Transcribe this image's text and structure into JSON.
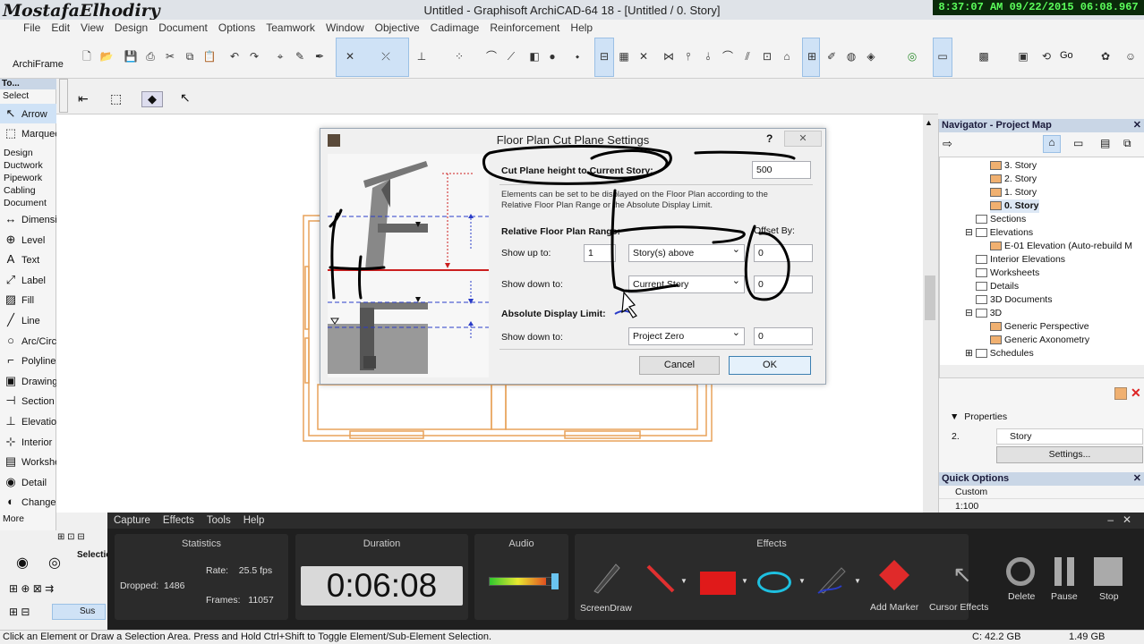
{
  "window": {
    "watermark": "MostafaElhodiry",
    "title": "Untitled - Graphisoft ArchiCAD-64 18 - [Untitled / 0. Story]",
    "clock": "8:37:07 AM 09/22/2015 06:08.967"
  },
  "menu": [
    "File",
    "Edit",
    "View",
    "Design",
    "Document",
    "Options",
    "Teamwork",
    "Window",
    "Objective",
    "Cadimage",
    "Reinforcement",
    "Help"
  ],
  "toolbar": {
    "archiframe": "ArchiFrame",
    "go": "Go"
  },
  "toolbox": {
    "header": "To...",
    "select_label": "Select",
    "tools": [
      {
        "label": "Arrow",
        "icon": "arrow-icon",
        "glyph": "↖"
      },
      {
        "label": "Marquee",
        "icon": "marquee-icon",
        "glyph": "⬚"
      }
    ],
    "groups": [
      "Design",
      "Ductwork",
      "Pipework",
      "Cabling",
      "Document"
    ],
    "doc_tools": [
      {
        "label": "Dimension",
        "icon": "dimension-icon",
        "glyph": "↔"
      },
      {
        "label": "Level",
        "icon": "level-icon",
        "glyph": "⊕"
      },
      {
        "label": "Text",
        "icon": "text-icon",
        "glyph": "A"
      },
      {
        "label": "Label",
        "icon": "label-icon",
        "glyph": "⤢"
      },
      {
        "label": "Fill",
        "icon": "fill-icon",
        "glyph": "▨"
      },
      {
        "label": "Line",
        "icon": "line-icon",
        "glyph": "╱"
      },
      {
        "label": "Arc/Circle",
        "icon": "circle-icon",
        "glyph": "○"
      },
      {
        "label": "Polyline",
        "icon": "polyline-icon",
        "glyph": "⌐"
      },
      {
        "label": "Drawing",
        "icon": "drawing-icon",
        "glyph": "▣"
      },
      {
        "label": "Section",
        "icon": "section-icon",
        "glyph": "⊣"
      },
      {
        "label": "Elevation",
        "icon": "elevation-icon",
        "glyph": "⊥"
      },
      {
        "label": "Interior",
        "icon": "interior-icon",
        "glyph": "⊹"
      },
      {
        "label": "Worksheet",
        "icon": "worksheet-icon",
        "glyph": "▤"
      },
      {
        "label": "Detail",
        "icon": "detail-icon",
        "glyph": "◉"
      },
      {
        "label": "Change",
        "icon": "change-icon",
        "glyph": "◐"
      }
    ],
    "more": "More"
  },
  "dialog": {
    "title": "Floor Plan Cut Plane Settings",
    "help": "?",
    "close": "✕",
    "cut_plane_label": "Cut Plane height to Current Story:",
    "cut_plane_value": "500",
    "description": "Elements can be set to be displayed on the Floor Plan according to the Relative Floor Plan Range or the Absolute Display Limit.",
    "relative_heading": "Relative Floor Plan Range:",
    "offset_by": "Offset By:",
    "show_up_to": "Show up to:",
    "up_count": "1",
    "up_select": "Story(s) above",
    "up_offset": "0",
    "show_down_to": "Show down to:",
    "down_select": "Current Story",
    "down_offset": "0",
    "absolute_heading": "Absolute Display Limit:",
    "abs_show_down_to": "Show down to:",
    "abs_select": "Project Zero",
    "abs_offset": "0",
    "cancel": "Cancel",
    "ok": "OK"
  },
  "navigator": {
    "title": "Navigator - Project Map",
    "items": [
      "3. Story",
      "2. Story",
      "1. Story",
      "0. Story",
      "Sections",
      "Elevations",
      "E-01 Elevation (Auto-rebuild M",
      "Interior Elevations",
      "Worksheets",
      "Details",
      "3D Documents",
      "3D",
      "Generic Perspective",
      "Generic Axonometry",
      "Schedules"
    ],
    "properties_label": "Properties",
    "prop_num": "2.",
    "prop_name": "Story",
    "settings_btn": "Settings..."
  },
  "quick_options": {
    "title": "Quick Options",
    "row1": "Custom",
    "row2": "1:100"
  },
  "recorder": {
    "menu": [
      "Capture",
      "Effects",
      "Tools",
      "Help"
    ],
    "statistics": {
      "title": "Statistics",
      "dropped_label": "Dropped:",
      "dropped": "1486",
      "rate_label": "Rate:",
      "rate": "25.5 fps",
      "frames_label": "Frames:",
      "frames": "11057"
    },
    "duration": {
      "title": "Duration",
      "value": "0:06:08"
    },
    "audio": {
      "title": "Audio",
      "level": 0.85
    },
    "effects": {
      "title": "Effects",
      "screendraw": "ScreenDraw",
      "add_marker": "Add Marker",
      "cursor_effects": "Cursor Effects"
    },
    "controls": {
      "delete": "Delete",
      "pause": "Pause",
      "stop": "Stop"
    }
  },
  "lower_left": {
    "selection": "Selectio",
    "sus": "Sus"
  },
  "status": {
    "message": "Click an Element or Draw a Selection Area. Press and Hold Ctrl+Shift to Toggle Element/Sub-Element Selection.",
    "disk_c": "C: 42.2 GB",
    "mem": "1.49 GB"
  },
  "colors": {
    "accent": "#cfe2f6",
    "wall": "#e8a25a",
    "dialog_red": "#cc1f1f",
    "blue_dash": "#2a3cc8"
  }
}
